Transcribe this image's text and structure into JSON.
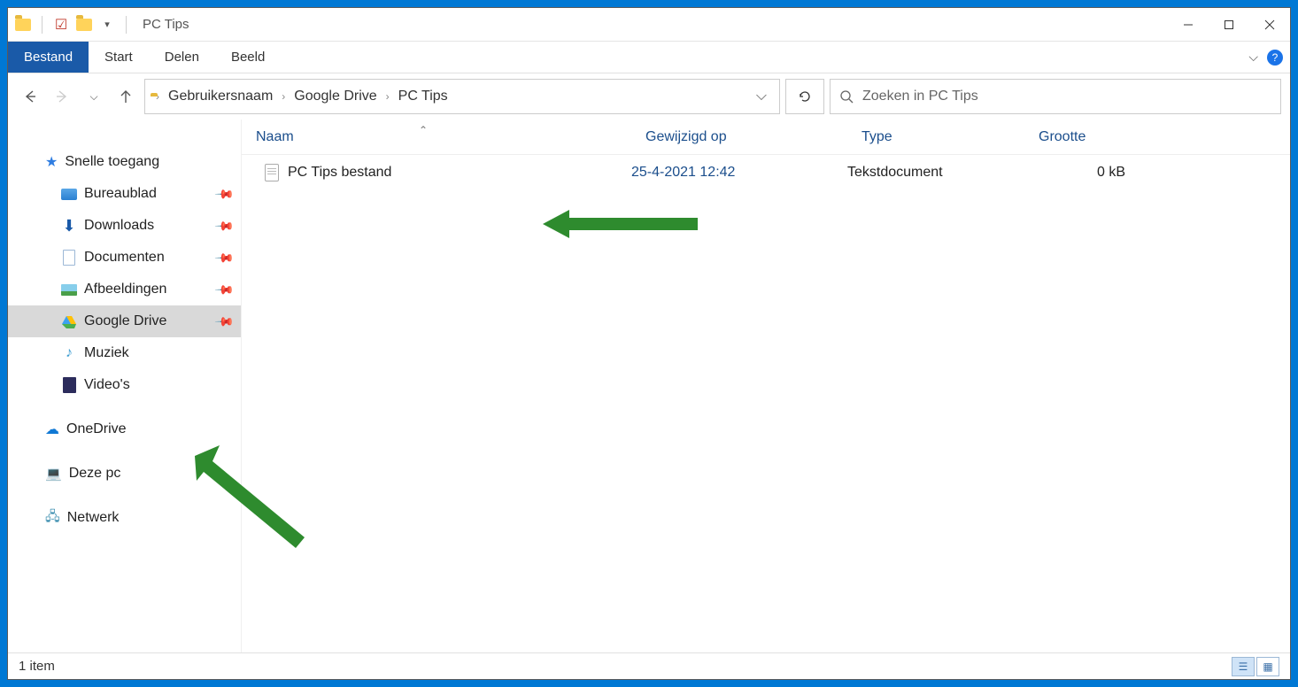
{
  "window": {
    "title": "PC Tips"
  },
  "menus": {
    "file": "Bestand",
    "start": "Start",
    "share": "Delen",
    "view": "Beeld"
  },
  "breadcrumb": [
    {
      "label": "Gebruikersnaam"
    },
    {
      "label": "Google Drive"
    },
    {
      "label": "PC Tips"
    }
  ],
  "search": {
    "placeholder": "Zoeken in PC Tips"
  },
  "columns": {
    "name": "Naam",
    "modified": "Gewijzigd op",
    "type": "Type",
    "size": "Grootte"
  },
  "sidebar": {
    "quick_label": "Snelle toegang",
    "items": [
      {
        "label": "Bureaublad",
        "pinned": true,
        "icon": "desktop"
      },
      {
        "label": "Downloads",
        "pinned": true,
        "icon": "download"
      },
      {
        "label": "Documenten",
        "pinned": true,
        "icon": "document"
      },
      {
        "label": "Afbeeldingen",
        "pinned": true,
        "icon": "picture"
      },
      {
        "label": "Google Drive",
        "pinned": true,
        "icon": "gdrive",
        "selected": true
      },
      {
        "label": "Muziek",
        "pinned": false,
        "icon": "music"
      },
      {
        "label": "Video's",
        "pinned": false,
        "icon": "video"
      }
    ],
    "onedrive": "OneDrive",
    "thispc": "Deze pc",
    "network": "Netwerk"
  },
  "files": [
    {
      "name": "PC Tips bestand",
      "modified": "25-4-2021 12:42",
      "type": "Tekstdocument",
      "size": "0 kB"
    }
  ],
  "status": {
    "count": "1 item"
  }
}
